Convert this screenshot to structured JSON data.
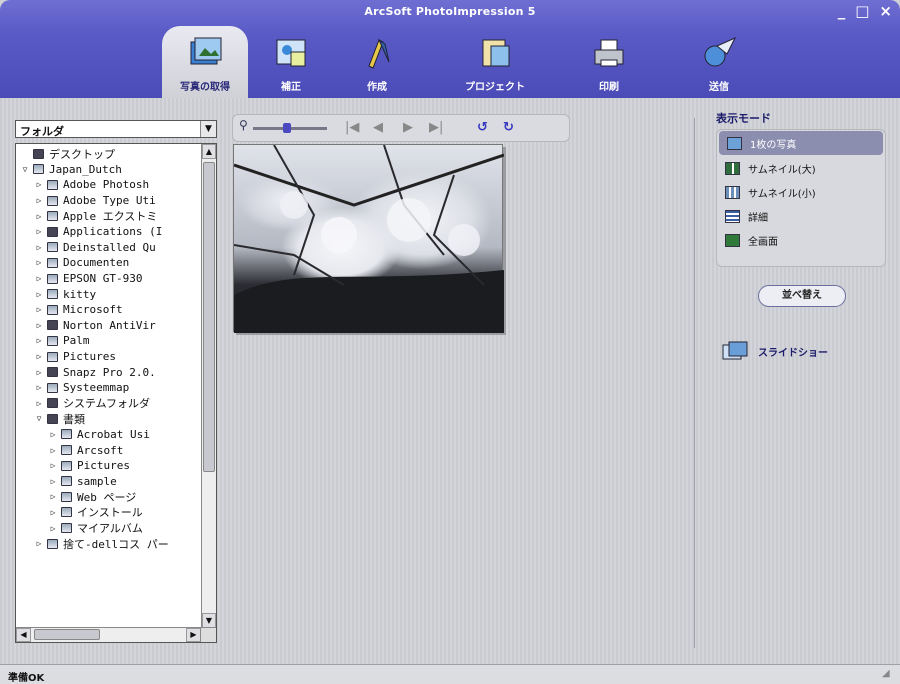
{
  "window": {
    "title": "ArcSoft PhotoImpression 5",
    "controls": [
      "_",
      "□",
      "×"
    ]
  },
  "tabs": [
    {
      "label": "写真の取得",
      "icon": "get-photo-icon",
      "active": true
    },
    {
      "label": "補正",
      "icon": "edit-icon",
      "active": false
    },
    {
      "label": "作成",
      "icon": "create-icon",
      "active": false
    },
    {
      "label": "プロジェクト",
      "icon": "project-icon",
      "active": false
    },
    {
      "label": "印刷",
      "icon": "printer-icon",
      "active": false
    },
    {
      "label": "送信",
      "icon": "send-icon",
      "active": false
    }
  ],
  "folder_panel": {
    "select_value": "フォルダ",
    "tree": [
      {
        "label": "デスクトップ",
        "indent": 0,
        "arrow": "",
        "icon": "desktop"
      },
      {
        "label": "Japan_Dutch",
        "indent": 0,
        "arrow": "▽",
        "icon": "drive"
      },
      {
        "label": "Adobe Photosh",
        "indent": 1,
        "arrow": "▷",
        "icon": "folder"
      },
      {
        "label": "Adobe Type Uti",
        "indent": 1,
        "arrow": "▷",
        "icon": "folder"
      },
      {
        "label": "Apple エクストミ",
        "indent": 1,
        "arrow": "▷",
        "icon": "folder"
      },
      {
        "label": "Applications (I",
        "indent": 1,
        "arrow": "▷",
        "icon": "folder-special"
      },
      {
        "label": "Deinstalled Qu",
        "indent": 1,
        "arrow": "▷",
        "icon": "folder"
      },
      {
        "label": "Documenten",
        "indent": 1,
        "arrow": "▷",
        "icon": "folder"
      },
      {
        "label": "EPSON GT-930",
        "indent": 1,
        "arrow": "▷",
        "icon": "folder"
      },
      {
        "label": "kitty",
        "indent": 1,
        "arrow": "▷",
        "icon": "folder"
      },
      {
        "label": "Microsoft",
        "indent": 1,
        "arrow": "▷",
        "icon": "folder"
      },
      {
        "label": "Norton AntiVir",
        "indent": 1,
        "arrow": "▷",
        "icon": "folder-special"
      },
      {
        "label": "Palm",
        "indent": 1,
        "arrow": "▷",
        "icon": "folder"
      },
      {
        "label": "Pictures",
        "indent": 1,
        "arrow": "▷",
        "icon": "folder"
      },
      {
        "label": "Snapz Pro 2.0.",
        "indent": 1,
        "arrow": "▷",
        "icon": "folder-special"
      },
      {
        "label": "Systeemmap",
        "indent": 1,
        "arrow": "▷",
        "icon": "folder"
      },
      {
        "label": "システムフォルダ",
        "indent": 1,
        "arrow": "▷",
        "icon": "folder-special"
      },
      {
        "label": "書類",
        "indent": 1,
        "arrow": "▽",
        "icon": "folder-special"
      },
      {
        "label": "Acrobat Usi",
        "indent": 2,
        "arrow": "▷",
        "icon": "folder"
      },
      {
        "label": "Arcsoft",
        "indent": 2,
        "arrow": "▷",
        "icon": "folder"
      },
      {
        "label": "Pictures",
        "indent": 2,
        "arrow": "▷",
        "icon": "folder"
      },
      {
        "label": "sample",
        "indent": 2,
        "arrow": "▷",
        "icon": "folder"
      },
      {
        "label": "Web ページ",
        "indent": 2,
        "arrow": "▷",
        "icon": "folder"
      },
      {
        "label": "インストール",
        "indent": 2,
        "arrow": "▷",
        "icon": "folder"
      },
      {
        "label": "マイアルバム",
        "indent": 2,
        "arrow": "▷",
        "icon": "folder"
      },
      {
        "label": "捨て-dellコス パー",
        "indent": 1,
        "arrow": "▷",
        "icon": "folder"
      }
    ]
  },
  "toolbar": {
    "zoom_icon": "magnifier-icon",
    "zoom_level": 0.4,
    "buttons": [
      {
        "name": "first",
        "glyph": "|◀",
        "icon": "first-icon",
        "active": false
      },
      {
        "name": "prev",
        "glyph": "◀",
        "icon": "prev-icon",
        "active": false
      },
      {
        "name": "next",
        "glyph": "▶",
        "icon": "next-icon",
        "active": false
      },
      {
        "name": "last",
        "glyph": "▶|",
        "icon": "last-icon",
        "active": false
      },
      {
        "name": "rotate-left",
        "glyph": "↺",
        "icon": "rotate-left-icon",
        "active": true
      },
      {
        "name": "rotate-right",
        "glyph": "↻",
        "icon": "rotate-right-icon",
        "active": true
      }
    ]
  },
  "display_mode": {
    "title": "表示モード",
    "options": [
      {
        "label": "1枚の写真",
        "icon": "single-photo-icon",
        "selected": true
      },
      {
        "label": "サムネイル(大)",
        "icon": "thumbnail-large-icon",
        "selected": false
      },
      {
        "label": "サムネイル(小)",
        "icon": "thumbnail-small-icon",
        "selected": false
      },
      {
        "label": "詳細",
        "icon": "details-icon",
        "selected": false
      },
      {
        "label": "全画面",
        "icon": "fullscreen-icon",
        "selected": false
      }
    ]
  },
  "sort_button_label": "並べ替え",
  "slideshow_label": "スライドショー",
  "status": "準備OK",
  "colors": {
    "header": "#5a5ac6",
    "accent": "#3436c0",
    "selected_mode": "#8c8eb0"
  }
}
